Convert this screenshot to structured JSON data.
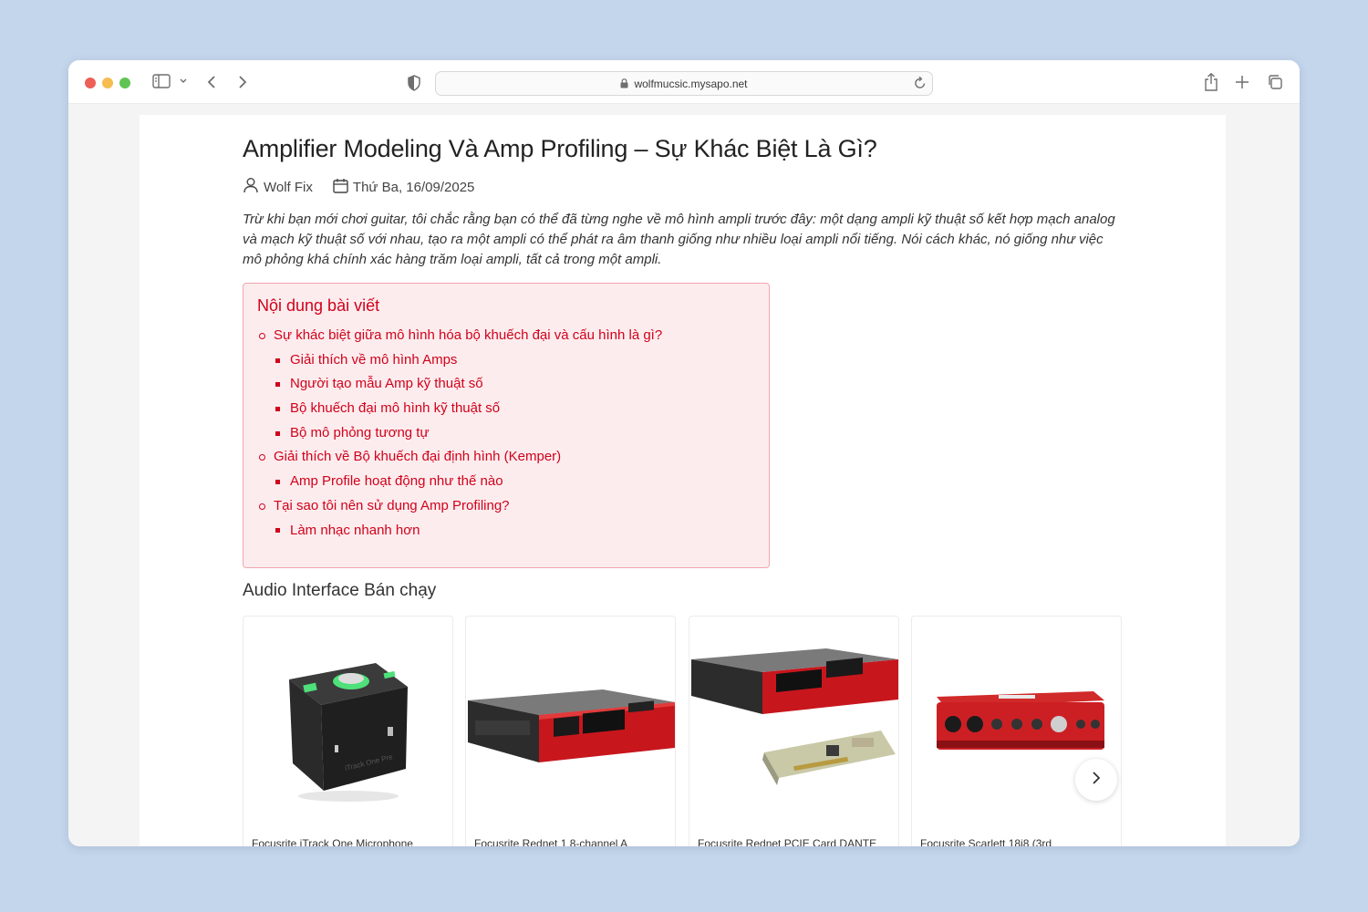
{
  "browser": {
    "url": "wolfmucsic.mysapo.net"
  },
  "article": {
    "title": "Amplifier Modeling Và Amp Profiling – Sự Khác Biệt Là Gì?",
    "author": "Wolf Fix",
    "date": "Thứ Ba, 16/09/2025",
    "intro": "Trừ khi bạn mới chơi guitar, tôi chắc rằng bạn có thể đã từng nghe về mô hình ampli trước đây: một dạng ampli kỹ thuật số kết hợp mạch analog và mạch kỹ thuật số với nhau, tạo ra một ampli có thể phát ra âm thanh giống như nhiều loại ampli nổi tiếng. Nói cách khác, nó giống như việc mô phỏng khá chính xác hàng trăm loại ampli, tất cả trong một ampli."
  },
  "toc": {
    "title": "Nội dung bài viết",
    "items": [
      {
        "level": 1,
        "label": "Sự khác biệt giữa mô hình hóa bộ khuếch đại và cấu hình là gì?"
      },
      {
        "level": 2,
        "label": "Giải thích về mô hình Amps"
      },
      {
        "level": 2,
        "label": "Người tạo mẫu Amp kỹ thuật số"
      },
      {
        "level": 2,
        "label": "Bộ khuếch đại mô hình kỹ thuật số"
      },
      {
        "level": 2,
        "label": "Bộ mô phỏng tương tự"
      },
      {
        "level": 1,
        "label": "Giải thích về Bộ khuếch đại định hình (Kemper)"
      },
      {
        "level": 2,
        "label": "Amp Profile hoạt động như thế nào"
      },
      {
        "level": 1,
        "label": "Tại sao tôi nên sử dụng Amp Profiling?"
      },
      {
        "level": 2,
        "label": "Làm nhạc nhanh hơn"
      }
    ]
  },
  "products_section": {
    "title": "Audio Interface Bán chạy",
    "items": [
      {
        "name": "Focusrite iTrack One Microphone",
        "image": "itrack-one-pre"
      },
      {
        "name": "Focusrite Rednet 1 8-channel A",
        "image": "rednet-1-rack"
      },
      {
        "name": "Focusrite Rednet PCIE Card DANTE",
        "image": "rednet-pcie-card"
      },
      {
        "name": "Focusrite Scarlett 18i8 (3rd",
        "image": "scarlett-18i8"
      }
    ]
  },
  "colors": {
    "accent": "#d0021b",
    "toc_bg": "#fdecee",
    "page_bg": "#c4d6ec"
  }
}
